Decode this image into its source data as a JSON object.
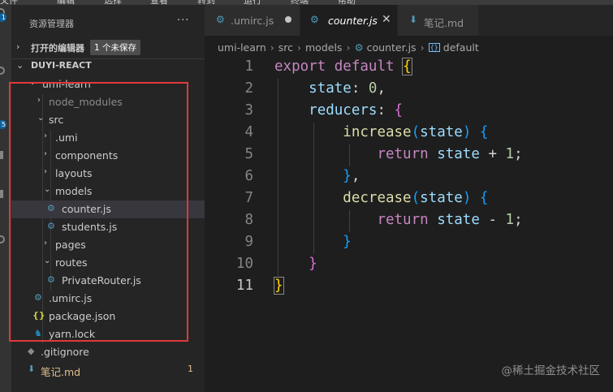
{
  "menubar": {
    "items": [
      "文件",
      "编辑",
      "选择",
      "查看",
      "转到",
      "运行",
      "终端",
      "帮助"
    ]
  },
  "activity": {
    "badges": [
      "1",
      "5"
    ]
  },
  "explorer": {
    "title": "资源管理器",
    "more": "···",
    "open_editors": {
      "label": "打开的编辑器",
      "badge": "1 个未保存"
    },
    "workspace": {
      "label": "DUYI-REACT"
    },
    "tree": [
      {
        "name": "umi-learn",
        "type": "folder",
        "open": true,
        "depth": 1
      },
      {
        "name": "node_modules",
        "type": "folder",
        "open": false,
        "depth": 2,
        "dim": true
      },
      {
        "name": "src",
        "type": "folder",
        "open": true,
        "depth": 2
      },
      {
        "name": ".umi",
        "type": "folder",
        "open": false,
        "depth": 3
      },
      {
        "name": "components",
        "type": "folder",
        "open": false,
        "depth": 3
      },
      {
        "name": "layouts",
        "type": "folder",
        "open": false,
        "depth": 3
      },
      {
        "name": "models",
        "type": "folder",
        "open": true,
        "depth": 3
      },
      {
        "name": "counter.js",
        "type": "js",
        "depth": 4,
        "active": true
      },
      {
        "name": "students.js",
        "type": "js",
        "depth": 4
      },
      {
        "name": "pages",
        "type": "folder",
        "open": false,
        "depth": 3
      },
      {
        "name": "routes",
        "type": "folder",
        "open": true,
        "depth": 3
      },
      {
        "name": "PrivateRouter.js",
        "type": "js",
        "depth": 4
      },
      {
        "name": ".umirc.js",
        "type": "js",
        "depth": 2
      },
      {
        "name": "package.json",
        "type": "json",
        "depth": 2
      },
      {
        "name": "yarn.lock",
        "type": "yarn",
        "depth": 2
      },
      {
        "name": ".gitignore",
        "type": "git",
        "depth": 1
      },
      {
        "name": "笔记.md",
        "type": "md",
        "depth": 1,
        "modified": true,
        "count": "1"
      }
    ]
  },
  "tabs": [
    {
      "name": ".umirc.js",
      "icon": "gear-icon",
      "dirty": true
    },
    {
      "name": "counter.js",
      "icon": "gear-icon",
      "active": true
    },
    {
      "name": "笔记.md",
      "icon": "markdown-icon"
    }
  ],
  "breadcrumb": [
    "umi-learn",
    "src",
    "models",
    "counter.js",
    "default"
  ],
  "code": {
    "lines": [
      {
        "n": "1"
      },
      {
        "n": "2"
      },
      {
        "n": "3"
      },
      {
        "n": "4"
      },
      {
        "n": "5"
      },
      {
        "n": "6"
      },
      {
        "n": "7"
      },
      {
        "n": "8"
      },
      {
        "n": "9"
      },
      {
        "n": "10"
      },
      {
        "n": "11"
      }
    ],
    "tokens": {
      "export": "export",
      "default": "default",
      "state": "state",
      "zero": "0",
      "reducers": "reducers",
      "increase": "increase",
      "decrease": "decrease",
      "param": "state",
      "ret": "return",
      "st": "state",
      "plus": "+",
      "minus": "-",
      "one": "1"
    }
  },
  "watermark": "@稀土掘金技术社区",
  "colors": {
    "highlight_box": "#e0383d",
    "accent": "#0e639c"
  }
}
